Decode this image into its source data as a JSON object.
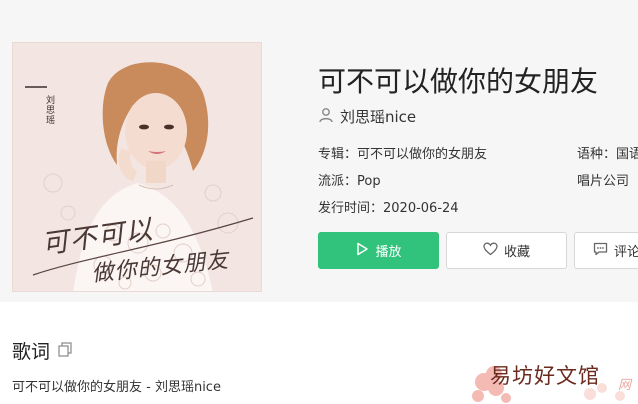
{
  "song": {
    "title": "可不可以做你的女朋友",
    "artist": "刘思瑶nice"
  },
  "cover": {
    "artist_text": "刘思瑶",
    "title_line_1": "可不可以",
    "title_line_2": "做你的女朋友"
  },
  "meta": {
    "album": "专辑：可不可以做你的女朋友",
    "genre": "流派：Pop",
    "release": "发行时间：2020-06-24",
    "language": "语种：国语",
    "label": "唱片公司"
  },
  "actions": {
    "play_label": "播放",
    "favorite_label": "收藏",
    "comment_label": "评论"
  },
  "lyrics": {
    "heading": "歌词",
    "first_line": "可不可以做你的女朋友 - 刘思瑶nice"
  },
  "watermark": {
    "text": "易坊好文馆",
    "suffix": "网"
  },
  "colors": {
    "accent": "#31c27c",
    "top_background": "#f6f6f6",
    "title_text": "#222222"
  }
}
